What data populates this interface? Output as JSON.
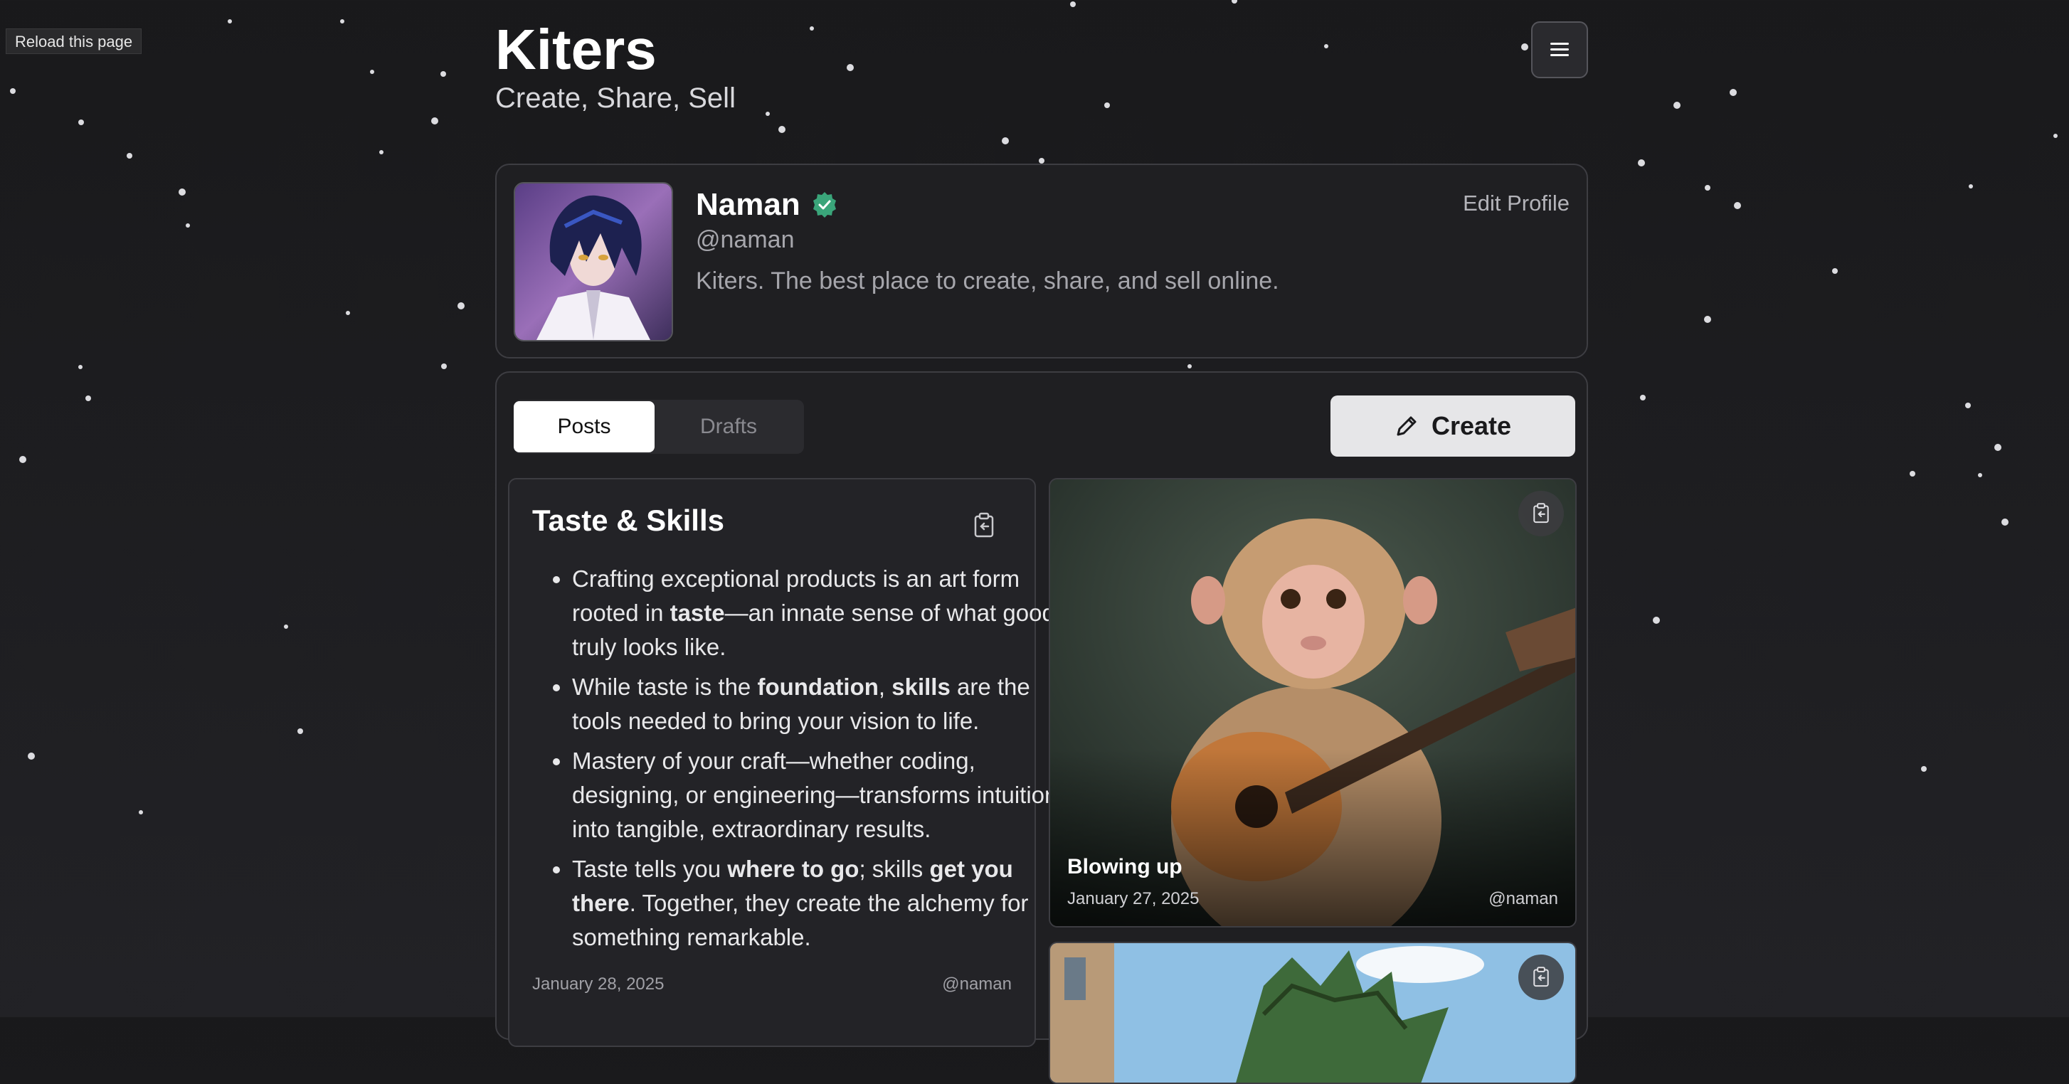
{
  "reload_label": "Reload this page",
  "header": {
    "brand": "Kiters",
    "tagline": "Create, Share, Sell"
  },
  "menu": {
    "icon": "hamburger-icon"
  },
  "profile": {
    "name": "Naman",
    "handle": "@naman",
    "bio": "Kiters. The best place to create, share, and sell online.",
    "edit_label": "Edit Profile",
    "verified_icon": "verified-badge-icon"
  },
  "tabs": [
    {
      "label": "Posts",
      "active": true
    },
    {
      "label": "Drafts",
      "active": false
    }
  ],
  "create_label": "Create",
  "posts": [
    {
      "title": "Taste & Skills",
      "items": [
        [
          {
            "t": "Crafting exceptional products is an art form rooted in ",
            "b": false
          },
          {
            "t": "taste",
            "b": true
          },
          {
            "t": "—an innate sense of what good truly looks like.",
            "b": false
          }
        ],
        [
          {
            "t": "While taste is the ",
            "b": false
          },
          {
            "t": "foundation",
            "b": true
          },
          {
            "t": ", ",
            "b": false
          },
          {
            "t": "skills",
            "b": true
          },
          {
            "t": " are the tools needed to bring your vision to life.",
            "b": false
          }
        ],
        [
          {
            "t": "Mastery of your craft—whether coding, designing, or engineering—transforms intuition into tangible, extraordinary results.",
            "b": false
          }
        ],
        [
          {
            "t": "Taste tells you ",
            "b": false
          },
          {
            "t": "where to go",
            "b": true
          },
          {
            "t": "; skills ",
            "b": false
          },
          {
            "t": "get you there",
            "b": true
          },
          {
            "t": ". Together, they create the alchemy for something remarkable.",
            "b": false
          }
        ]
      ],
      "date": "January 28, 2025",
      "author": "@naman"
    },
    {
      "title": "Blowing up",
      "date": "January 27, 2025",
      "author": "@naman"
    }
  ],
  "colors": {
    "background": "#1c1c1e",
    "card_border": "#3d3d42",
    "verified": "#3aa57a",
    "create_bg": "#e6e6e8"
  }
}
